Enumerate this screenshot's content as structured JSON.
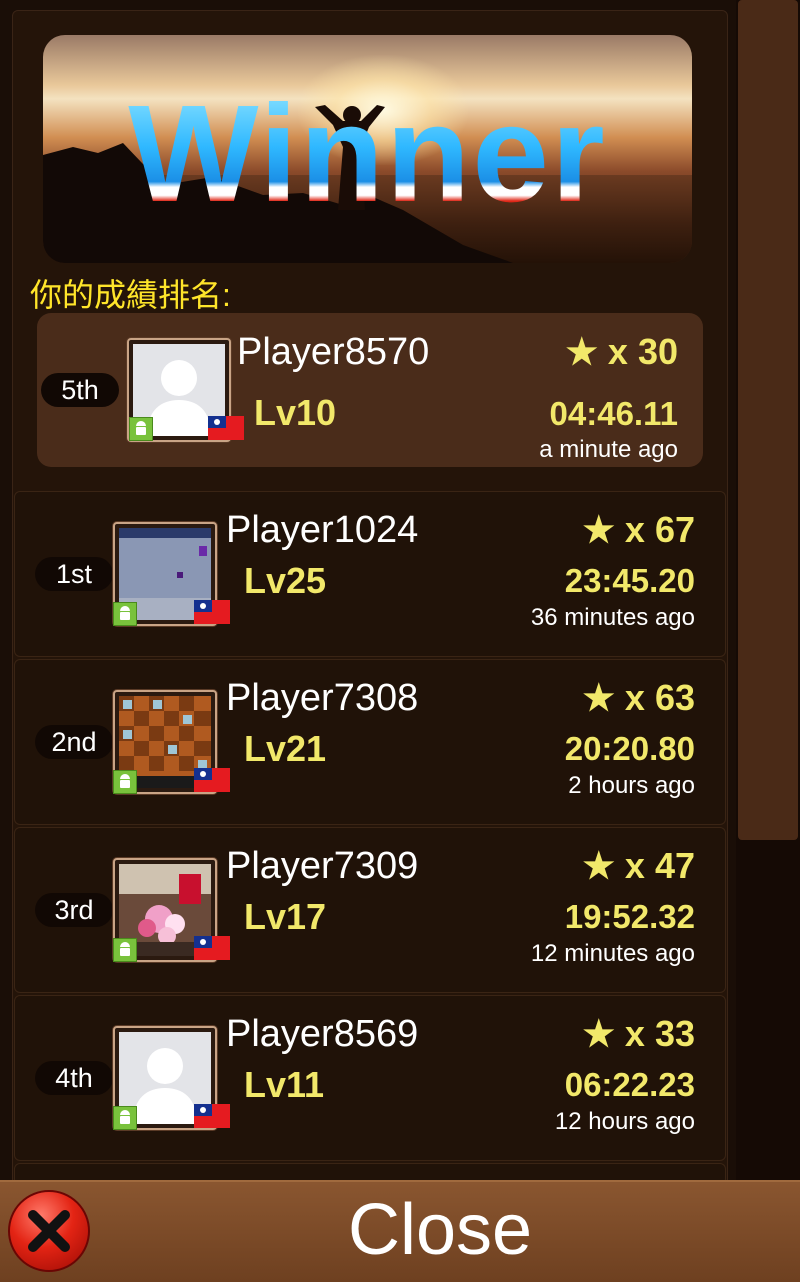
{
  "banner": {
    "title": "Winner"
  },
  "heading": "你的成績排名:",
  "my_entry": {
    "rank": "5th",
    "name": "Player8570",
    "level": "Lv10",
    "stars": "★ x 30",
    "time": "04:46.11",
    "ago": "a minute ago",
    "avatar": "silhouette-placeholder"
  },
  "leaderboard": [
    {
      "rank": "1st",
      "name": "Player1024",
      "level": "Lv25",
      "stars": "★ x 67",
      "time": "23:45.20",
      "ago": "36 minutes ago",
      "avatar": "game-screenshot"
    },
    {
      "rank": "2nd",
      "name": "Player7308",
      "level": "Lv21",
      "stars": "★ x 63",
      "time": "20:20.80",
      "ago": "2 hours ago",
      "avatar": "mahjong-board"
    },
    {
      "rank": "3rd",
      "name": "Player7309",
      "level": "Lv17",
      "stars": "★ x 47",
      "time": "19:52.32",
      "ago": "12 minutes ago",
      "avatar": "flower-bouquet"
    },
    {
      "rank": "4th",
      "name": "Player8569",
      "level": "Lv11",
      "stars": "★ x 33",
      "time": "06:22.23",
      "ago": "12 hours ago",
      "avatar": "silhouette-placeholder"
    }
  ],
  "platform_icon": "android-icon",
  "country_flag": "taiwan-flag",
  "close_button": {
    "label": "Close",
    "icon": "close-x-icon"
  },
  "colors": {
    "accent_yellow": "#f2e86a",
    "heading_yellow": "#ffe52a",
    "panel_brown": "#241409",
    "highlight_row": "#4a2c1a",
    "close_red": "#e32414"
  }
}
